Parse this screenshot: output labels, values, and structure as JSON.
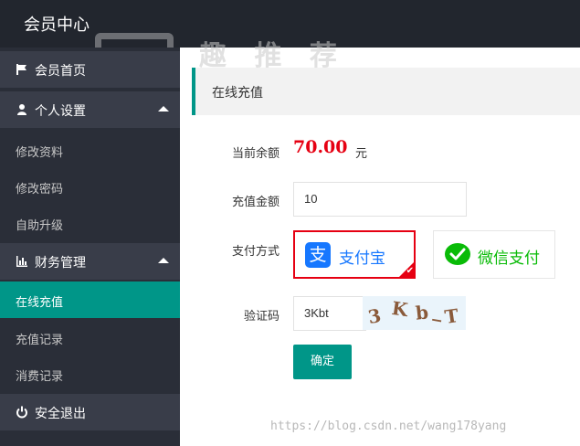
{
  "header": {
    "title": "会员中心",
    "watermark": "趣 推 荐"
  },
  "sidebar": {
    "home": {
      "label": "会员首页",
      "icon": "flag-icon"
    },
    "personal": {
      "label": "个人设置",
      "icon": "user-icon",
      "items": [
        "修改资料",
        "修改密码",
        "自助升级"
      ]
    },
    "finance": {
      "label": "财务管理",
      "icon": "bar-chart-icon",
      "items": [
        "在线充值",
        "充值记录",
        "消费记录"
      ]
    },
    "logout": {
      "label": "安全退出",
      "icon": "power-icon"
    }
  },
  "panel": {
    "title": "在线充值"
  },
  "form": {
    "balance_label": "当前余额",
    "balance_value": "70.00",
    "balance_unit": "元",
    "amount_label": "充值金额",
    "amount_value": "10",
    "method_label": "支付方式",
    "alipay_label": "支付宝",
    "wechat_label": "微信支付",
    "captcha_label": "验证码",
    "captcha_value": "3Kbt",
    "captcha_image_text": "3 K b _T",
    "submit_label": "确定"
  },
  "footer": {
    "watermark": "https://blog.csdn.net/wang178yang"
  },
  "colors": {
    "accent": "#009688",
    "balance": "#e60012",
    "alipay": "#1677ff",
    "wechat": "#09bb07",
    "topbar": "#22262e"
  }
}
